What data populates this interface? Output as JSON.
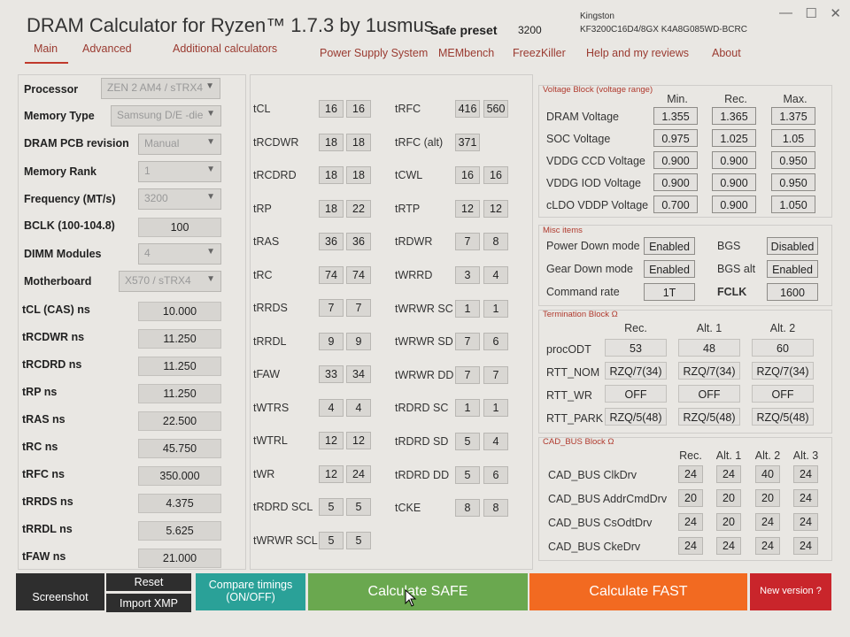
{
  "app": {
    "title": "DRAM Calculator for Ryzen™ 1.7.3 by 1usmus",
    "preset_label": "Safe preset",
    "preset_value": "3200",
    "kingston_lines": [
      "Kingston",
      "KF3200C16D4/8GX   K4A8G085WD-BCRC"
    ],
    "window_buttons": [
      "—",
      "☐",
      "✕"
    ]
  },
  "tabs": [
    "Main",
    "Advanced",
    "Additional calculators",
    "Power Supply System",
    "MEMbench",
    "FreezKiller",
    "Help and my reviews",
    "About"
  ],
  "left": {
    "processor": {
      "label": "Processor",
      "value": "ZEN 2 AM4 / sTRX4"
    },
    "memory_type": {
      "label": "Memory Type",
      "value": "Samsung D/E -die"
    },
    "pcb": {
      "label": "DRAM PCB revision",
      "value": "Manual"
    },
    "rank": {
      "label": "Memory Rank",
      "value": "1"
    },
    "freq": {
      "label": "Frequency (MT/s)",
      "value": "3200"
    },
    "bclk": {
      "label": "BCLK (100-104.8)",
      "value": "100"
    },
    "dimm": {
      "label": "DIMM Modules",
      "value": "4"
    },
    "mobo": {
      "label": "Motherboard",
      "value": "X570 / sTRX4"
    },
    "ns": [
      {
        "label": "tCL (CAS) ns",
        "value": "10.000"
      },
      {
        "label": "tRCDWR ns",
        "value": "11.250"
      },
      {
        "label": "tRCDRD ns",
        "value": "11.250"
      },
      {
        "label": "tRP ns",
        "value": "11.250"
      },
      {
        "label": "tRAS ns",
        "value": "22.500"
      },
      {
        "label": "tRC ns",
        "value": "45.750"
      },
      {
        "label": "tRFC ns",
        "value": "350.000"
      },
      {
        "label": "tRRDS ns",
        "value": "4.375"
      },
      {
        "label": "tRRDL ns",
        "value": "5.625"
      },
      {
        "label": "tFAW ns",
        "value": "21.000"
      }
    ]
  },
  "timings_col1": [
    {
      "label": "tCL",
      "a": "16",
      "b": "16"
    },
    {
      "label": "tRCDWR",
      "a": "18",
      "b": "18"
    },
    {
      "label": "tRCDRD",
      "a": "18",
      "b": "18"
    },
    {
      "label": "tRP",
      "a": "18",
      "b": "22"
    },
    {
      "label": "tRAS",
      "a": "36",
      "b": "36"
    },
    {
      "label": "tRC",
      "a": "74",
      "b": "74"
    },
    {
      "label": "tRRDS",
      "a": "7",
      "b": "7"
    },
    {
      "label": "tRRDL",
      "a": "9",
      "b": "9"
    },
    {
      "label": "tFAW",
      "a": "33",
      "b": "34"
    },
    {
      "label": "tWTRS",
      "a": "4",
      "b": "4"
    },
    {
      "label": "tWTRL",
      "a": "12",
      "b": "12"
    },
    {
      "label": "tWR",
      "a": "12",
      "b": "24"
    },
    {
      "label": "tRDRD SCL",
      "a": "5",
      "b": "5"
    },
    {
      "label": "tWRWR SCL",
      "a": "5",
      "b": "5"
    }
  ],
  "timings_col2": [
    {
      "label": "tRFC",
      "a": "416",
      "b": "560"
    },
    {
      "label": "tRFC (alt)",
      "a": "371",
      "b": ""
    },
    {
      "label": "tCWL",
      "a": "16",
      "b": "16"
    },
    {
      "label": "tRTP",
      "a": "12",
      "b": "12"
    },
    {
      "label": "tRDWR",
      "a": "7",
      "b": "8"
    },
    {
      "label": "tWRRD",
      "a": "3",
      "b": "4"
    },
    {
      "label": "tWRWR SC",
      "a": "1",
      "b": "1"
    },
    {
      "label": "tWRWR SD",
      "a": "7",
      "b": "6"
    },
    {
      "label": "tWRWR DD",
      "a": "7",
      "b": "7"
    },
    {
      "label": "tRDRD SC",
      "a": "1",
      "b": "1"
    },
    {
      "label": "tRDRD SD",
      "a": "5",
      "b": "4"
    },
    {
      "label": "tRDRD DD",
      "a": "5",
      "b": "6"
    },
    {
      "label": "tCKE",
      "a": "8",
      "b": "8"
    }
  ],
  "voltage": {
    "title": "Voltage Block (voltage range)",
    "headers": [
      "Min.",
      "Rec.",
      "Max."
    ],
    "rows": [
      {
        "label": "DRAM Voltage",
        "v": [
          "1.355",
          "1.365",
          "1.375"
        ]
      },
      {
        "label": "SOC Voltage",
        "v": [
          "0.975",
          "1.025",
          "1.05"
        ]
      },
      {
        "label": "VDDG  CCD Voltage",
        "v": [
          "0.900",
          "0.900",
          "0.950"
        ]
      },
      {
        "label": "VDDG  IOD Voltage",
        "v": [
          "0.900",
          "0.900",
          "0.950"
        ]
      },
      {
        "label": "cLDO VDDP Voltage",
        "v": [
          "0.700",
          "0.900",
          "1.050"
        ]
      }
    ]
  },
  "misc": {
    "title": "Misc items",
    "rows": [
      {
        "l1": "Power Down mode",
        "v1": "Enabled",
        "l2": "BGS",
        "v2": "Disabled",
        "bold2": false
      },
      {
        "l1": "Gear Down mode",
        "v1": "Enabled",
        "l2": "BGS alt",
        "v2": "Enabled",
        "bold2": false
      },
      {
        "l1": "Command rate",
        "v1": "1T",
        "l2": "FCLK",
        "v2": "1600",
        "bold2": true
      }
    ]
  },
  "termination": {
    "title": "Termination Block Ω",
    "headers": [
      "Rec.",
      "Alt. 1",
      "Alt. 2"
    ],
    "rows": [
      {
        "label": "procODT",
        "v": [
          "53",
          "48",
          "60"
        ]
      },
      {
        "label": "RTT_NOM",
        "v": [
          "RZQ/7(34)",
          "RZQ/7(34)",
          "RZQ/7(34)"
        ]
      },
      {
        "label": "RTT_WR",
        "v": [
          "OFF",
          "OFF",
          "OFF"
        ]
      },
      {
        "label": "RTT_PARK",
        "v": [
          "RZQ/5(48)",
          "RZQ/5(48)",
          "RZQ/5(48)"
        ]
      }
    ]
  },
  "cadbus": {
    "title": "CAD_BUS Block Ω",
    "headers": [
      "Rec.",
      "Alt. 1",
      "Alt. 2",
      "Alt. 3"
    ],
    "rows": [
      {
        "label": "CAD_BUS ClkDrv",
        "v": [
          "24",
          "24",
          "40",
          "24"
        ]
      },
      {
        "label": "CAD_BUS AddrCmdDrv",
        "v": [
          "20",
          "20",
          "20",
          "24"
        ]
      },
      {
        "label": "CAD_BUS CsOdtDrv",
        "v": [
          "24",
          "20",
          "24",
          "24"
        ]
      },
      {
        "label": "CAD_BUS CkeDrv",
        "v": [
          "24",
          "24",
          "24",
          "24"
        ]
      }
    ]
  },
  "footer": {
    "screenshot": "Screenshot",
    "reset": "Reset",
    "import_xmp": "Import XMP",
    "compare_line1": "Compare timings",
    "compare_line2": "(ON/OFF)",
    "calc_safe": "Calculate SAFE",
    "calc_fast": "Calculate FAST",
    "new_version": "New version ?"
  },
  "colors": {
    "accent": "#c0392b",
    "footer_dark": "#2e2e2e",
    "footer_teal": "#2aa198",
    "footer_green": "#6aa84f",
    "footer_orange": "#f26a21",
    "footer_red": "#c9252b"
  }
}
